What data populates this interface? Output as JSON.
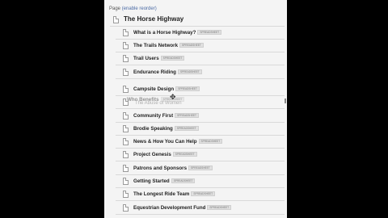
{
  "header": {
    "label": "Page",
    "link": "(enable reorder)"
  },
  "root_page": {
    "title": "The Horse Highway"
  },
  "pages": [
    {
      "title": "What is a Horse Highway?",
      "tag": "SPREADSHEET"
    },
    {
      "title": "The Trails Network",
      "tag": "SPREADSHEET"
    },
    {
      "title": "Trail Users",
      "tag": "SPREADSHEET"
    },
    {
      "title": "Endurance Riding",
      "tag": "SPREADSHEET"
    },
    {
      "title": "Campsite Design",
      "tag": "SPREADSHEET"
    },
    {
      "title": "",
      "tag": ""
    },
    {
      "title": "Community First",
      "tag": "SPREADSHEET"
    },
    {
      "title": "Brodie Speaking",
      "tag": "SPREADSHEET"
    },
    {
      "title": "News & How You Can Help",
      "tag": "SPREADSHEET"
    },
    {
      "title": "Project Genesis",
      "tag": "SPREADSHEET"
    },
    {
      "title": "Patrons and Sponsors",
      "tag": "SPREADSHEET"
    },
    {
      "title": "Getting Started",
      "tag": "SPREADSHEET"
    },
    {
      "title": "The Longest Ride Team",
      "tag": "SPREADSHEET"
    },
    {
      "title": "Equestrian Development Fund",
      "tag": "SPREADSHEET"
    }
  ],
  "dragging": {
    "title": "Who Benefits",
    "tag": "SPREADSHEET",
    "ghost_text": "The Abuse of Women"
  }
}
